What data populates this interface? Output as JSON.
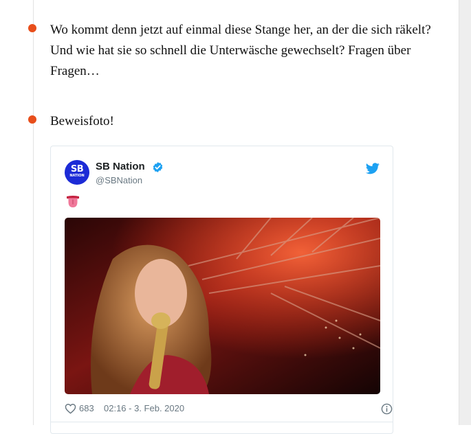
{
  "entries": [
    {
      "text": "Wo kommt denn jetzt auf einmal diese Stange her, an der die sich räkelt? Und wie hat sie so schnell die Unterwäsche gewechselt? Fragen über Fragen…"
    },
    {
      "text": "Beweisfoto!"
    }
  ],
  "tweet": {
    "author_name": "SB Nation",
    "author_handle": "@SBNation",
    "avatar_line1": "SB",
    "avatar_line2": "NATION",
    "body_emoji_icon": "tongue-emoji-icon",
    "like_count": "683",
    "timestamp": "02:16 - 3. Feb. 2020",
    "accent_color": "#1da1f2"
  },
  "colors": {
    "bullet": "#e84e1b",
    "avatar_bg": "#1c2bd6"
  }
}
